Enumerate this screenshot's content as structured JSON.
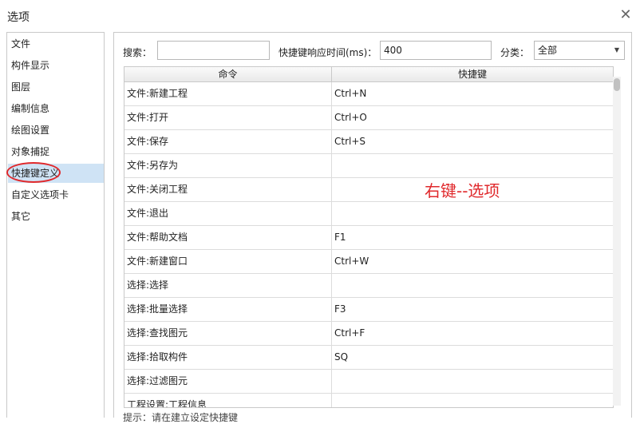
{
  "window": {
    "title": "选项",
    "close_glyph": "✕"
  },
  "sidebar": {
    "items": [
      {
        "label": "文件",
        "selected": false
      },
      {
        "label": "构件显示",
        "selected": false
      },
      {
        "label": "图层",
        "selected": false
      },
      {
        "label": "编制信息",
        "selected": false
      },
      {
        "label": "绘图设置",
        "selected": false
      },
      {
        "label": "对象捕捉",
        "selected": false
      },
      {
        "label": "快捷键定义",
        "selected": true
      },
      {
        "label": "自定义选项卡",
        "selected": false
      },
      {
        "label": "其它",
        "selected": false
      }
    ]
  },
  "toolbar": {
    "search_label": "搜索：",
    "search_value": "",
    "response_label": "快捷键响应时间(ms)：",
    "response_value": "400",
    "category_label": "分类：",
    "category_value": "全部"
  },
  "table": {
    "headers": [
      "命令",
      "快捷键"
    ],
    "rows": [
      {
        "command": "文件:新建工程",
        "shortcut": "Ctrl+N"
      },
      {
        "command": "文件:打开",
        "shortcut": "Ctrl+O"
      },
      {
        "command": "文件:保存",
        "shortcut": "Ctrl+S"
      },
      {
        "command": "文件:另存为",
        "shortcut": ""
      },
      {
        "command": "文件:关闭工程",
        "shortcut": ""
      },
      {
        "command": "文件:退出",
        "shortcut": ""
      },
      {
        "command": "文件:帮助文档",
        "shortcut": "F1"
      },
      {
        "command": "文件:新建窗口",
        "shortcut": "Ctrl+W"
      },
      {
        "command": "选择:选择",
        "shortcut": ""
      },
      {
        "command": "选择:批量选择",
        "shortcut": "F3"
      },
      {
        "command": "选择:查找图元",
        "shortcut": "Ctrl+F"
      },
      {
        "command": "选择:拾取构件",
        "shortcut": "SQ"
      },
      {
        "command": "选择:过滤图元",
        "shortcut": ""
      },
      {
        "command": "工程设置:工程信息",
        "shortcut": ""
      }
    ]
  },
  "annotation": {
    "text": "右键--选项",
    "color": "#e0292c"
  },
  "footer": {
    "hint": "提示：请在建立设定快捷键"
  },
  "colors": {
    "selected_bg": "#cfe3f5",
    "highlight_red": "#e0292c"
  }
}
